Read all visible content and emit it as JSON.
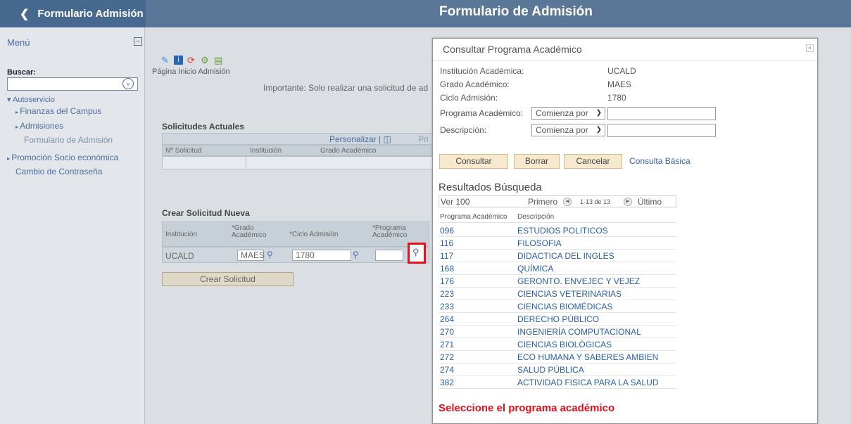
{
  "header": {
    "back_label": "Formulario Admisión",
    "app_title": "Formulario de Admisión"
  },
  "menu": {
    "title": "Menú",
    "search_label": "Buscar:",
    "search_value": "",
    "items": [
      {
        "label": "Autoservicio"
      },
      {
        "label": "Finanzas del Campus"
      },
      {
        "label": "Admisiones"
      },
      {
        "label": "Formulario de Admisión"
      },
      {
        "label": "Promoción Socio económica"
      },
      {
        "label": "Cambio de Contraseña"
      }
    ]
  },
  "main": {
    "page_label": "Página Inicio Admisión",
    "importante": "Importante: Solo realizar una solicitud de ad",
    "solicitudes_title": "Solicitudes Actuales",
    "personalizar": "Personalizar",
    "first_link": "Pri",
    "columns": [
      "Nº Solicitud",
      "Institución",
      "Grado Académico"
    ],
    "crear_title": "Crear Solicitud Nueva",
    "crear_columns": [
      {
        "line1": "Institución",
        "line2": ""
      },
      {
        "line1": "*Grado",
        "line2": "Académico"
      },
      {
        "line1": "*Ciclo Admisión",
        "line2": ""
      },
      {
        "line1": "*Programa",
        "line2": "Académico"
      }
    ],
    "crear_row": {
      "institucion": "UCALD",
      "grado": "MAES",
      "ciclo": "1780",
      "programa": ""
    },
    "crear_button": "Crear Solicitud"
  },
  "modal": {
    "title": "Consultar Programa Académico",
    "fields": [
      {
        "label": "Institución Académica:",
        "value": "UCALD"
      },
      {
        "label": "Grado Académico:",
        "value": "MAES"
      },
      {
        "label": "Ciclo Admisión:",
        "value": "1780"
      }
    ],
    "programa_label": "Programa Académico:",
    "programa_operator": "Comienza por",
    "programa_value": "",
    "descripcion_label": "Descripción:",
    "descripcion_operator": "Comienza por",
    "descripcion_value": "",
    "buttons": {
      "consultar": "Consultar",
      "borrar": "Borrar",
      "cancelar": "Cancelar",
      "basica": "Consulta Básica"
    },
    "results_title": "Resultados Búsqueda",
    "ver": "Ver 100",
    "primero": "Primero",
    "range": "1-13 de 13",
    "ultimo": "Último",
    "col_codigo": "Programa Académico",
    "col_desc": "Descripción",
    "results": [
      {
        "code": "096",
        "desc": "ESTUDIOS POLITICOS"
      },
      {
        "code": "116",
        "desc": "FILOSOFIA"
      },
      {
        "code": "117",
        "desc": "DIDACTICA DEL INGLES"
      },
      {
        "code": "168",
        "desc": "QUÍMICA"
      },
      {
        "code": "176",
        "desc": "GERONTO. ENVEJEC Y VEJEZ"
      },
      {
        "code": "223",
        "desc": "CIENCIAS VETERINARIAS"
      },
      {
        "code": "233",
        "desc": "CIENCIAS BIOMÉDICAS"
      },
      {
        "code": "264",
        "desc": "DERECHO PÚBLICO"
      },
      {
        "code": "270",
        "desc": "INGENIERÍA COMPUTACIONAL"
      },
      {
        "code": "271",
        "desc": "CIENCIAS BIOLÓGICAS"
      },
      {
        "code": "272",
        "desc": "ECO HUMANA Y SABERES AMBIEN"
      },
      {
        "code": "274",
        "desc": "SALUD PÚBLICA"
      },
      {
        "code": "382",
        "desc": "ACTIVIDAD FISICA PARA LA SALUD"
      }
    ],
    "instruction": "Seleccione el programa académico"
  }
}
